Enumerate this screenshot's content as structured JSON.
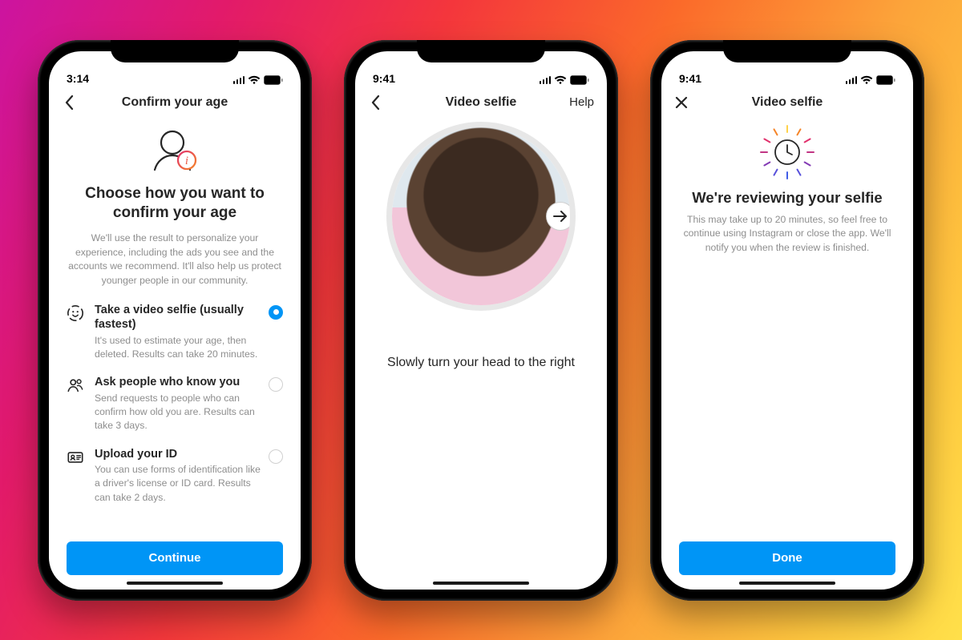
{
  "colors": {
    "primary": "#0095f6",
    "accent_pink": "#e1306c",
    "accent_orange": "#f58529",
    "accent_yellow": "#ffd24a"
  },
  "status": {
    "screen1_time": "3:14",
    "screen2_time": "9:41",
    "screen3_time": "9:41"
  },
  "screen1": {
    "nav_title": "Confirm your age",
    "heading": "Choose how you want to confirm your age",
    "sub": "We'll use the result to personalize your experience, including the ads you see and the accounts we recommend. It'll also help us protect younger people in our community.",
    "options": [
      {
        "icon": "face-scan-icon",
        "title": "Take a video selfie (usually fastest)",
        "desc": "It's used to estimate your age, then deleted. Results can take 20 minutes.",
        "selected": true
      },
      {
        "icon": "people-icon",
        "title": "Ask people who know you",
        "desc": "Send requests to people who can confirm how old you are. Results can take 3 days.",
        "selected": false
      },
      {
        "icon": "id-card-icon",
        "title": "Upload your ID",
        "desc": "You can use forms of identification like a driver's license or ID card. Results can take 2 days.",
        "selected": false
      }
    ],
    "cta": "Continue"
  },
  "screen2": {
    "nav_title": "Video selfie",
    "help_label": "Help",
    "instruction": "Slowly turn your head to the right",
    "arrow_direction": "right"
  },
  "screen3": {
    "nav_title": "Video selfie",
    "heading": "We're reviewing your selfie",
    "desc": "This may take up to 20 minutes, so feel free to continue using Instagram or close the app. We'll notify you when the review is finished.",
    "cta": "Done"
  }
}
